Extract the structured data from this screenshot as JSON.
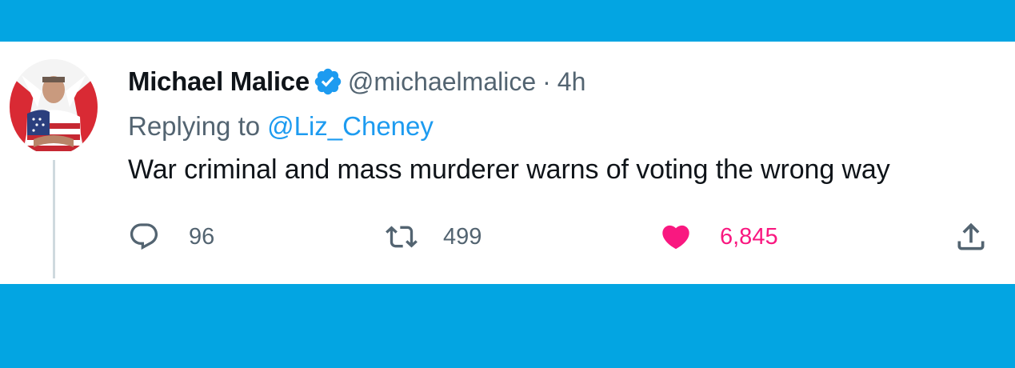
{
  "tweet": {
    "author": {
      "display_name": "Michael Malice",
      "handle": "@michaelmalice",
      "verified": true,
      "avatar_icon": "avatar-flag-portrait"
    },
    "separator": "·",
    "time": "4h",
    "reply_prefix": "Replying to",
    "reply_to": "@Liz_Cheney",
    "text": "War criminal and mass murderer warns of voting the wrong way",
    "actions": {
      "reply_count": "96",
      "retweet_count": "499",
      "like_count": "6,845",
      "liked": true
    }
  },
  "colors": {
    "frame": "#03a5e2",
    "card": "#ffffff",
    "text": "#0f1419",
    "secondary": "#536471",
    "link": "#1d9bf0",
    "like": "#f91880",
    "verified": "#1d9bf0"
  }
}
